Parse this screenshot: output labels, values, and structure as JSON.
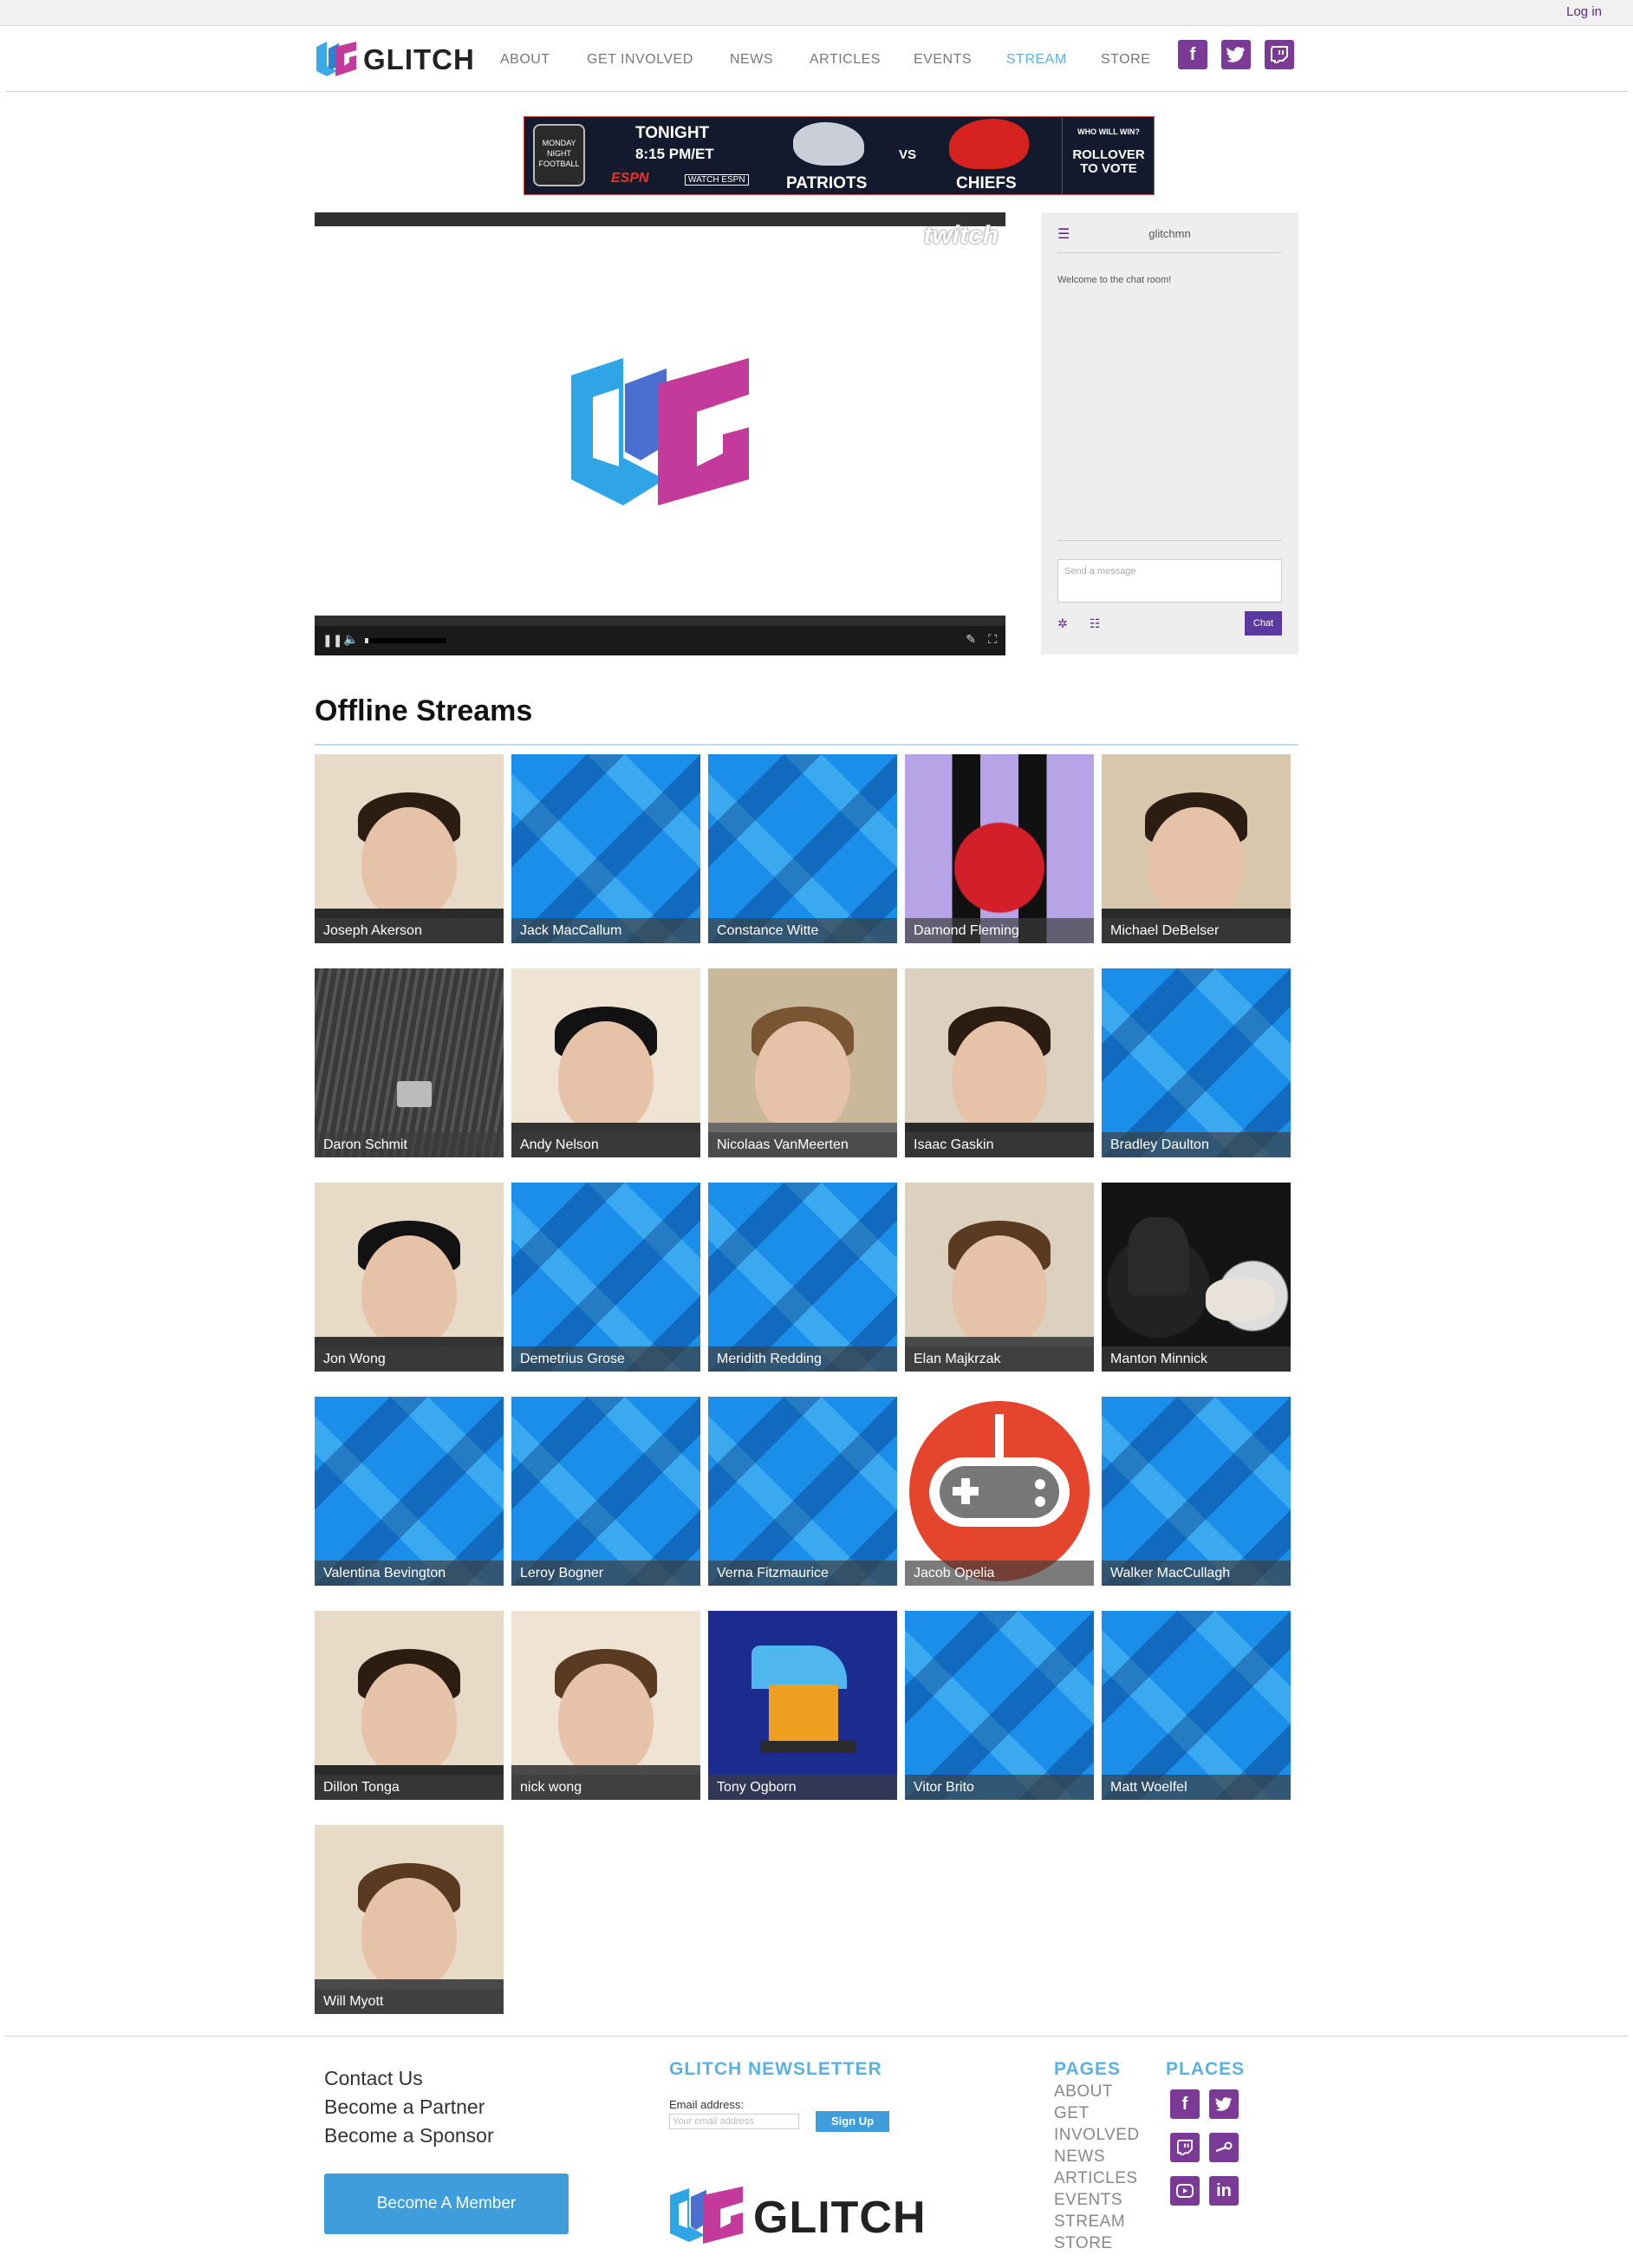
{
  "topbar": {
    "login": "Log in"
  },
  "brand": {
    "name": "GLITCH"
  },
  "nav": [
    {
      "label": "ABOUT"
    },
    {
      "label": "GET INVOLVED"
    },
    {
      "label": "NEWS"
    },
    {
      "label": "ARTICLES"
    },
    {
      "label": "EVENTS"
    },
    {
      "label": "STREAM",
      "active": true
    },
    {
      "label": "STORE"
    }
  ],
  "social_header": [
    "facebook-icon",
    "twitter-icon",
    "twitch-icon"
  ],
  "ad": {
    "tonight": "TONIGHT",
    "time": "8:15 PM/ET",
    "watch": "WATCH ESPN",
    "espn": "ESPN",
    "espn_badge": "MONDAY NIGHT FOOTBALL",
    "team1": "PATRIOTS",
    "vs": "VS",
    "team2": "CHIEFS",
    "who": "WHO WILL WIN?",
    "cta": "ROLLOVER TO VOTE"
  },
  "player": {
    "watermark": "twitch"
  },
  "chat": {
    "channel": "glitchmn",
    "welcome": "Welcome to the chat room!",
    "placeholder": "Send a message",
    "button": "Chat"
  },
  "offline": {
    "title": "Offline Streams",
    "streams": [
      {
        "name": "Joseph Akerson",
        "img": "face"
      },
      {
        "name": "Jack MacCallum",
        "img": "blue"
      },
      {
        "name": "Constance Witte",
        "img": "blue"
      },
      {
        "name": "Damond Fleming",
        "img": "art"
      },
      {
        "name": "Michael DeBelser",
        "img": "face"
      },
      {
        "name": "Daron Schmit",
        "img": "jacket"
      },
      {
        "name": "Andy Nelson",
        "img": "face"
      },
      {
        "name": "Nicolaas VanMeerten",
        "img": "face"
      },
      {
        "name": "Isaac Gaskin",
        "img": "face"
      },
      {
        "name": "Bradley Daulton",
        "img": "blue"
      },
      {
        "name": "Jon Wong",
        "img": "face"
      },
      {
        "name": "Demetrius Grose",
        "img": "blue"
      },
      {
        "name": "Meridith Redding",
        "img": "blue"
      },
      {
        "name": "Elan Majkrzak",
        "img": "face"
      },
      {
        "name": "Manton Minnick",
        "img": "dark"
      },
      {
        "name": "Valentina Bevington",
        "img": "blue"
      },
      {
        "name": "Leroy Bogner",
        "img": "blue"
      },
      {
        "name": "Verna Fitzmaurice",
        "img": "blue"
      },
      {
        "name": "Jacob Opelia",
        "img": "controller"
      },
      {
        "name": "Walker MacCullagh",
        "img": "blue"
      },
      {
        "name": "Dillon Tonga",
        "img": "face"
      },
      {
        "name": "nick wong",
        "img": "face"
      },
      {
        "name": "Tony Ogborn",
        "img": "pixel"
      },
      {
        "name": "Vitor Brito",
        "img": "blue"
      },
      {
        "name": "Matt Woelfel",
        "img": "blue"
      },
      {
        "name": "Will Myott",
        "img": "face"
      }
    ]
  },
  "footer": {
    "links": [
      "Contact Us",
      "Become a Partner",
      "Become a Sponsor"
    ],
    "member_button": "Become A Member",
    "newsletter_title": "GLITCH NEWSLETTER",
    "email_label": "Email address:",
    "email_placeholder": "Your email address",
    "signup": "Sign Up",
    "pages_title": "PAGES",
    "pages": [
      "ABOUT",
      "GET",
      "INVOLVED",
      "NEWS",
      "ARTICLES",
      "EVENTS",
      "STREAM",
      "STORE"
    ],
    "places_title": "PLACES",
    "places": [
      "facebook-icon",
      "twitter-icon",
      "twitch-icon",
      "steam-icon",
      "youtube-icon",
      "linkedin-icon"
    ]
  },
  "colors": {
    "brand_purple": "#7b3a96",
    "accent_blue": "#5ab1e2",
    "button_blue": "#3f9ddb"
  }
}
